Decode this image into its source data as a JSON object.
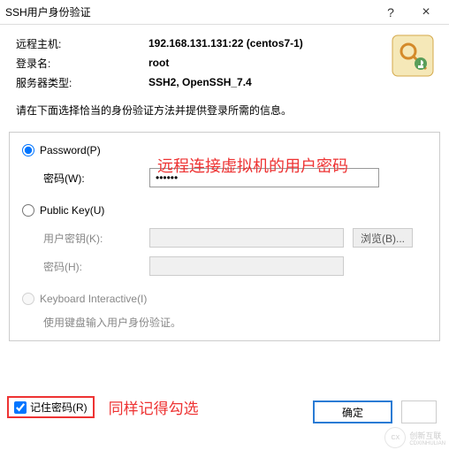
{
  "titlebar": {
    "title": "SSH用户身份验证",
    "help": "?",
    "close": "×"
  },
  "info": {
    "remote_host_label": "远程主机:",
    "remote_host_value": "192.168.131.131:22 (centos7-1)",
    "login_label": "登录名:",
    "login_value": "root",
    "server_type_label": "服务器类型:",
    "server_type_value": "SSH2, OpenSSH_7.4"
  },
  "instruction": "请在下面选择恰当的身份验证方法并提供登录所需的信息。",
  "auth": {
    "password_radio": "Password(P)",
    "password_field_label": "密码(W):",
    "password_value": "●●●●●●",
    "publickey_radio": "Public Key(U)",
    "userkey_label": "用户密钥(K):",
    "userkey_value": "",
    "browse_label": "浏览(B)...",
    "pk_password_label": "密码(H):",
    "interactive_radio": "Keyboard Interactive(I)",
    "interactive_note": "使用键盘输入用户身份验证。"
  },
  "annotations": {
    "red1": "远程连接虚拟机的用户密码",
    "red2": "同样记得勾选"
  },
  "remember": {
    "label": "记住密码(R)"
  },
  "buttons": {
    "ok": "确定",
    "cancel": ""
  },
  "watermark": {
    "text": "创新互联",
    "sub": "CDXINHULIAN"
  }
}
